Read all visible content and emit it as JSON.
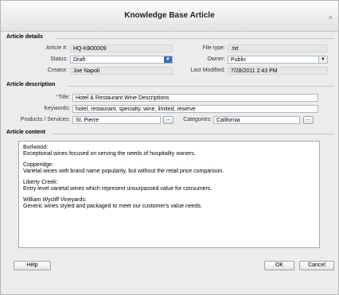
{
  "dialog": {
    "title": "Knowledge Base Article",
    "close_glyph": "×"
  },
  "details": {
    "heading": "Article details",
    "article_no_label": "Article #:",
    "article_no": "HQ-KB00009",
    "file_type_label": "File type:",
    "file_type": ".txt",
    "status_label": "Status:",
    "status": "Draft",
    "owner_label": "Owner:",
    "owner": "Public",
    "creator_label": "Creator:",
    "creator": "Joe Napoli",
    "last_modified_label": "Last Modified:",
    "last_modified": "7/28/2011 2:43 PM"
  },
  "description": {
    "heading": "Article description",
    "required_mark": "*",
    "title_label": "Title:",
    "title": "Hotel & Restaurant Wine Descriptions",
    "keywords_label": "Keywords:",
    "keywords": "hotel, restaurant, specialty, wine, limited, reserve",
    "products_label": "Products / Services:",
    "products": "St. Pierre",
    "categories_label": "Categories:",
    "categories": "California",
    "browse_label": "..."
  },
  "content": {
    "heading": "Article content",
    "paragraphs": [
      "Burlwood:\nExceptional wines focused on serving the needs of hospitality owners.",
      "Copperidge:\nVarietal wines with brand name popularity, but without the retail price comparison.",
      "Liberty Creek:\nEntry level varietal wines which represent unsurpassed value for consumers.",
      "William Wycliff Vineyards:\nGeneric wines styled and packaged to meet our customer's value needs."
    ]
  },
  "buttons": {
    "help": "Help",
    "ok": "OK",
    "cancel": "Cancel"
  },
  "icons": {
    "dropdown": "chevron-down-icon",
    "close": "close-icon"
  },
  "colors": {
    "dropdown_accent": "#3d6db3",
    "required": "#dd2222"
  }
}
